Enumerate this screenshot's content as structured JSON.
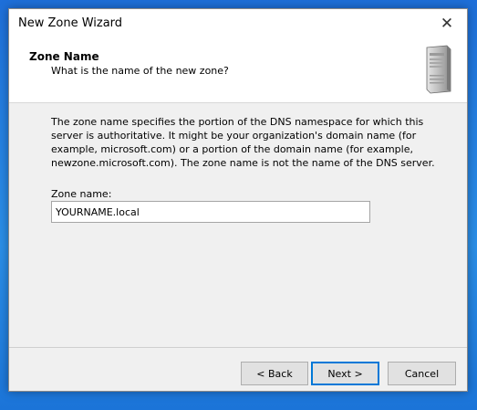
{
  "window": {
    "title": "New Zone Wizard",
    "close_glyph": "✕"
  },
  "header": {
    "title": "Zone Name",
    "subtitle": "What is the name of the new zone?",
    "icon": "server-icon"
  },
  "body": {
    "description": "The zone name specifies the portion of the DNS namespace for which this server is authoritative. It might be your organization's domain name (for example,  microsoft.com) or a portion of the domain name (for example, newzone.microsoft.com). The zone name is not the name of the DNS server.",
    "zone_name_label": "Zone name:",
    "zone_name_value": "YOURNAME.local"
  },
  "buttons": {
    "back": "< Back",
    "next": "Next >",
    "cancel": "Cancel"
  },
  "colors": {
    "desktop_blue": "#1e6fd9",
    "dialog_bg": "#f0f0f0",
    "focus_blue": "#0078d7"
  }
}
